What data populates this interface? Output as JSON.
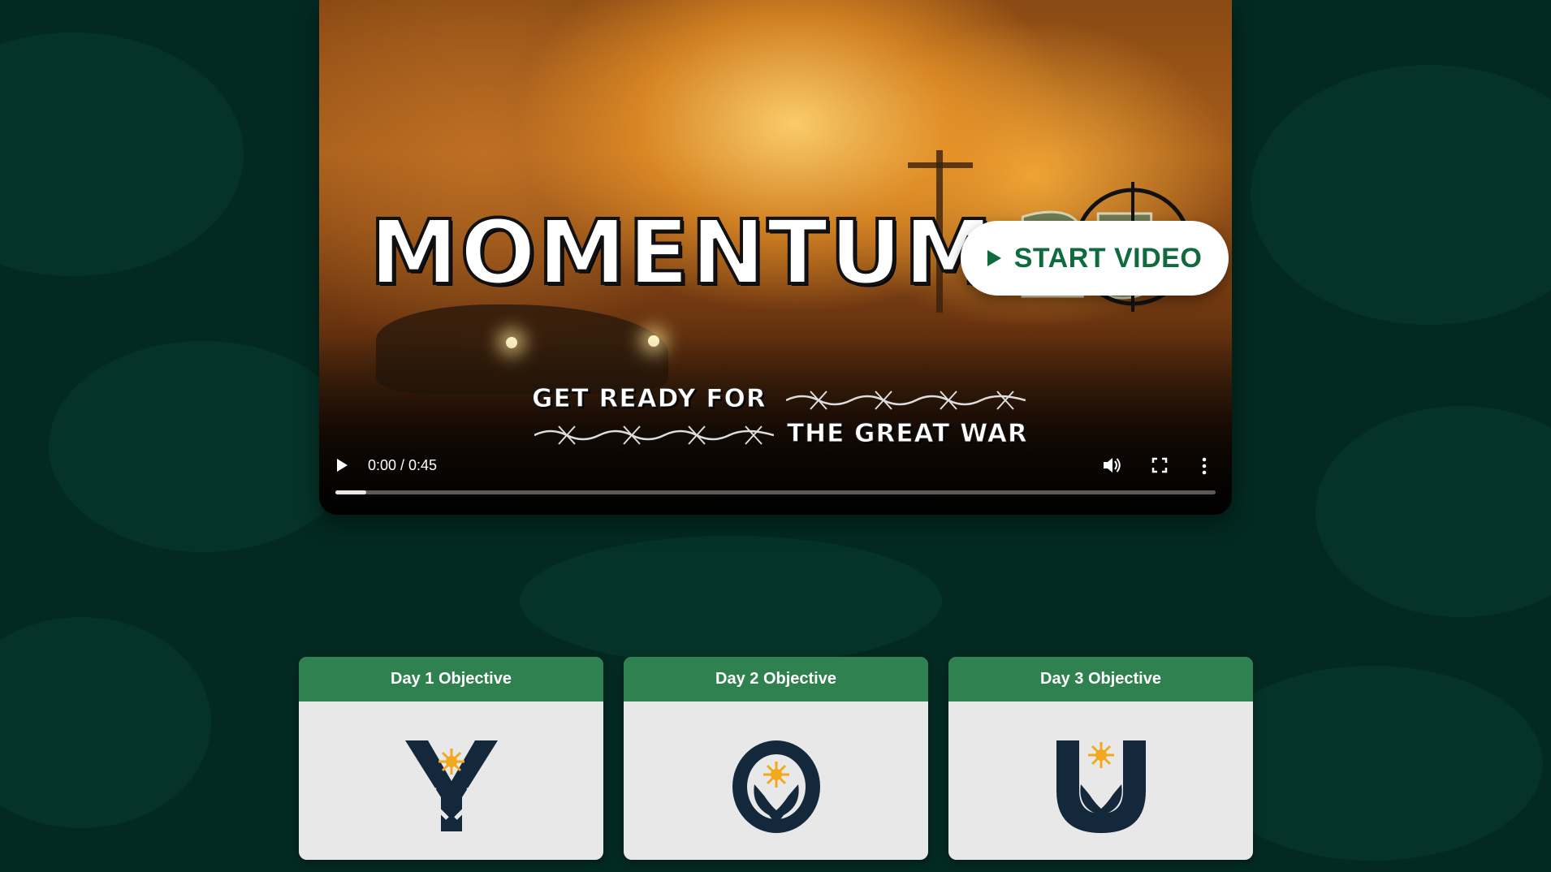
{
  "video": {
    "title_text": "MOMENTUM",
    "year_text": "25",
    "tagline_line1": "GET READY FOR",
    "tagline_line2": "THE GREAT WAR",
    "start_button_label": "START VIDEO",
    "time_display": "0:00 / 0:45",
    "progress": 0.035
  },
  "cards": [
    {
      "header": "Day 1 Objective",
      "icon": "y-hands-sun-icon"
    },
    {
      "header": "Day 2 Objective",
      "icon": "o-hands-sun-icon"
    },
    {
      "header": "Day 3 Objective",
      "icon": "u-hands-sun-icon"
    }
  ],
  "colors": {
    "background": "#032a22",
    "card_header": "#2f8150",
    "card_body": "#e8e8e8",
    "accent_green": "#0f6a3e",
    "icon_navy": "#14283c",
    "icon_sun": "#f2a81d"
  }
}
